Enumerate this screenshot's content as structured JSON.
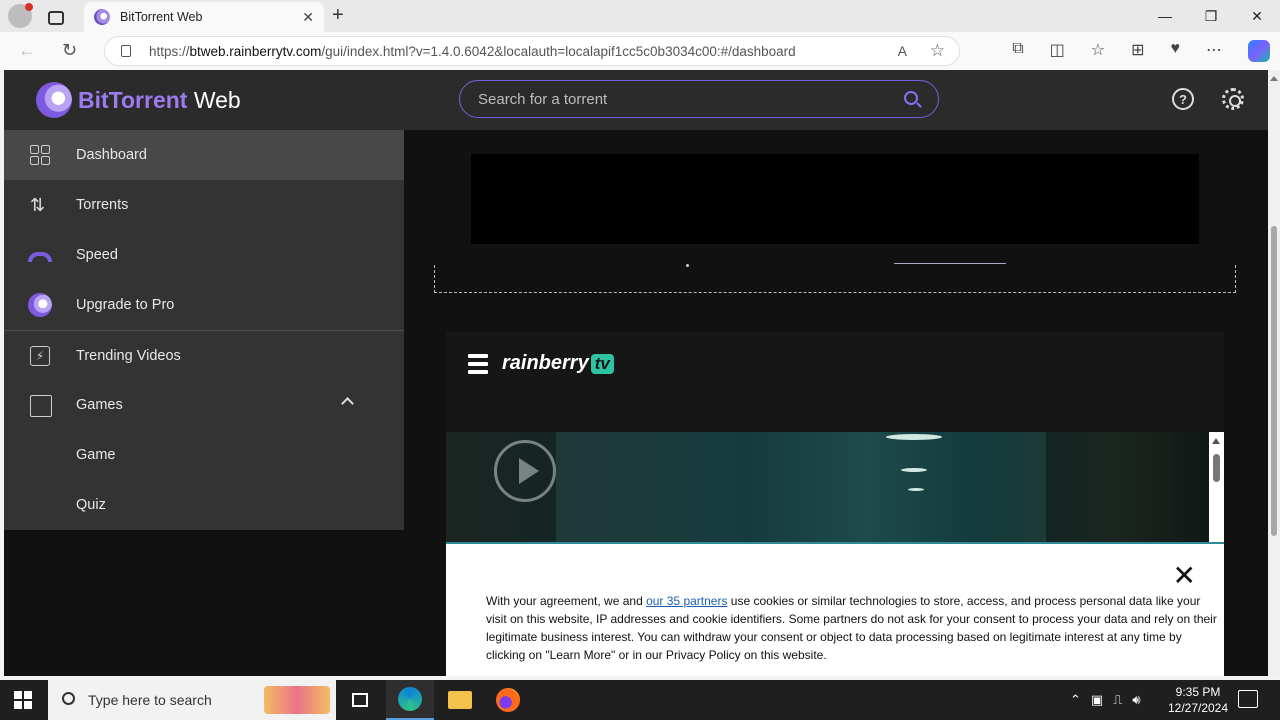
{
  "browser": {
    "tab_title": "BitTorrent Web",
    "url_prefix": "https://",
    "url_host": "btweb.rainberrytv.com",
    "url_rest": "/gui/index.html?v=1.4.0.6042&localauth=localapif1cc5c0b3034c00:#/dashboard"
  },
  "app": {
    "logo_bold": "BitTorrent",
    "logo_light": " Web",
    "search_placeholder": "Search for a torrent",
    "help_glyph": "?"
  },
  "sidebar": {
    "items": [
      {
        "label": "Dashboard",
        "icon": "dashboard-icon",
        "active": true
      },
      {
        "label": "Torrents",
        "icon": "arrows-updown-icon"
      },
      {
        "label": "Speed",
        "icon": "speedometer-icon"
      },
      {
        "label": "Upgrade to Pro",
        "icon": "bittorrent-pro-icon"
      },
      {
        "label": "Trending Videos",
        "icon": "lightning-video-icon"
      },
      {
        "label": "Games",
        "icon": "gamepad-icon",
        "expanded": true
      },
      {
        "label": "Game"
      },
      {
        "label": "Quiz"
      }
    ]
  },
  "rainberry": {
    "logo_text": "rainberry",
    "logo_badge": "tv"
  },
  "consent": {
    "text_before": "With your agreement, we and ",
    "link": "our 35 partners",
    "text_after": " use cookies or similar technologies to store, access, and process personal data like your visit on this website, IP addresses and cookie identifiers. Some partners do not ask for your consent to process your data and rely on their legitimate business interest. You can withdraw your consent or object to data processing based on legitimate interest at any time by clicking on \"Learn More\" or in our Privacy Policy on this website.",
    "close_glyph": "✕"
  },
  "taskbar": {
    "search_placeholder": "Type here to search",
    "time": "9:35 PM",
    "date": "12/27/2024"
  },
  "colors": {
    "accent": "#7a5cdc",
    "sidebar_bg": "#333333",
    "header_bg": "#2b2b2b"
  }
}
